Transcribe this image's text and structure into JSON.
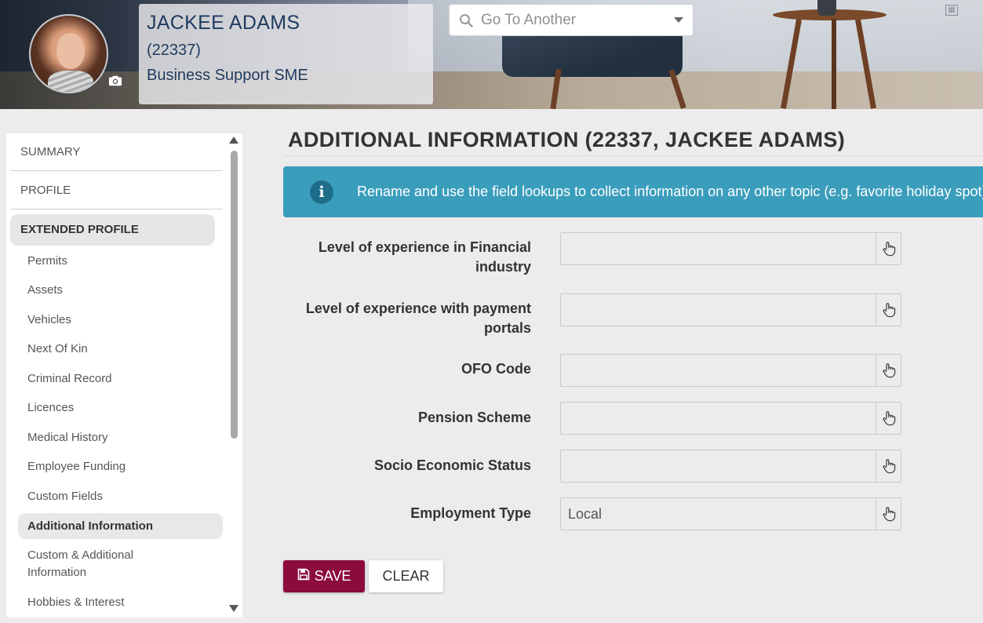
{
  "header": {
    "employee_name": "JACKEE ADAMS",
    "employee_code": "(22337)",
    "job_title": "Business Support SME",
    "goto_placeholder": "Go To Another"
  },
  "sidebar": {
    "top_items": [
      "SUMMARY",
      "PROFILE"
    ],
    "section": "EXTENDED PROFILE",
    "sub_items": [
      "Permits",
      "Assets",
      "Vehicles",
      "Next Of Kin",
      "Criminal Record",
      "Licences",
      "Medical History",
      "Employee Funding",
      "Custom Fields",
      "Additional Information",
      "Custom & Additional Information",
      "Hobbies & Interest"
    ],
    "active_item": "Additional Information"
  },
  "main": {
    "title": "ADDITIONAL INFORMATION (22337, JACKEE ADAMS)",
    "info_message": "Rename and use the field lookups to collect information on any other topic (e.g. favorite holiday spot) th",
    "fields": [
      {
        "label": "Level of experience in Financial industry",
        "value": ""
      },
      {
        "label": "Level of experience with payment portals",
        "value": ""
      },
      {
        "label": "OFO Code",
        "value": ""
      },
      {
        "label": "Pension Scheme",
        "value": ""
      },
      {
        "label": "Socio Economic Status",
        "value": ""
      },
      {
        "label": "Employment Type",
        "value": "Local"
      }
    ],
    "save_label": "SAVE",
    "clear_label": "CLEAR"
  },
  "colors": {
    "accent": "#8b0c3c",
    "info_banner": "#3a9dbc",
    "name_text": "#1f3a5f"
  },
  "icons": [
    "camera-icon",
    "search-icon",
    "dropdown-caret-icon",
    "info-icon",
    "hand-pointer-icon",
    "save-icon",
    "grid-icon"
  ]
}
